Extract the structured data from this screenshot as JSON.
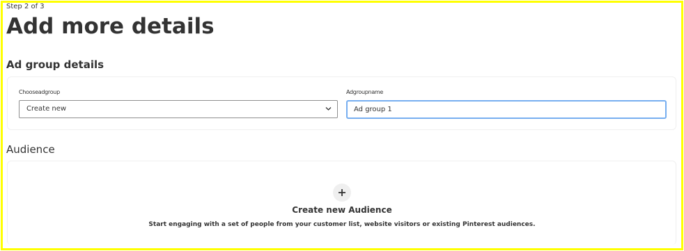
{
  "header": {
    "step": "Step 2 of 3",
    "title": "Add more details"
  },
  "ad_group": {
    "heading": "Ad group details",
    "choose_label": "Chooseadgroup",
    "choose_value": "Create new",
    "name_label": "Adgroupname",
    "name_value": "Ad group 1"
  },
  "audience": {
    "heading": "Audience",
    "create_title": "Create new Audience",
    "create_description": "Start engaging with a set of people from your customer list, website visitors or existing Pinterest audiences."
  },
  "colors": {
    "highlight_border": "#ffff00",
    "focus_border": "#76aef0",
    "text": "#333333"
  }
}
